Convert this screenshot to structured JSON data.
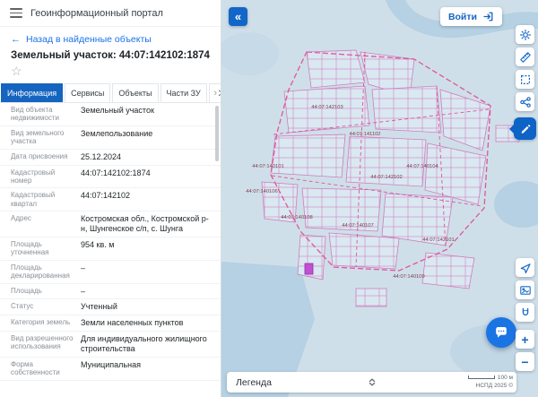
{
  "app": {
    "title": "Геоинформационный портал"
  },
  "icons": {
    "star": "☆",
    "back_arrow": "←",
    "tabs_more": "›"
  },
  "panel": {
    "back_link": "Назад в найденные объекты",
    "title": "Земельный участок: 44:07:142102:1874",
    "tabs": [
      {
        "label": "Информация"
      },
      {
        "label": "Сервисы"
      },
      {
        "label": "Объекты"
      },
      {
        "label": "Части ЗУ"
      },
      {
        "label": "Сост"
      }
    ],
    "rows": [
      {
        "label": "Вид объекта недвижимости",
        "value": "Земельный участок"
      },
      {
        "label": "Вид земельного участка",
        "value": "Землепользование"
      },
      {
        "label": "Дата присвоения",
        "value": "25.12.2024"
      },
      {
        "label": "Кадастровый номер",
        "value": "44:07:142102:1874"
      },
      {
        "label": "Кадастровый квартал",
        "value": "44:07:142102"
      },
      {
        "label": "Адрес",
        "value": "Костромская обл., Костромской р-н, Шунгенское с/п, с. Шунга"
      },
      {
        "label": "Площадь уточненная",
        "value": "954 кв. м"
      },
      {
        "label": "Площадь декларированная",
        "value": "–"
      },
      {
        "label": "Площадь",
        "value": "–"
      },
      {
        "label": "Статус",
        "value": "Учтенный"
      },
      {
        "label": "Категория земель",
        "value": "Земли населенных пунктов"
      },
      {
        "label": "Вид разрешенного использования",
        "value": "Для индивидуального жилищного строительства"
      },
      {
        "label": "Форма собственности",
        "value": "Муниципальная"
      }
    ]
  },
  "map": {
    "collapse_glyph": "«",
    "login_label": "Войти",
    "legend_label": "Легенда",
    "scale_label": "100 м",
    "attribution": "НСПД 2025 ©",
    "zoom_in": "+",
    "zoom_out": "−",
    "quarters": [
      {
        "text": "44:07:142103"
      },
      {
        "text": "44:07:141102"
      },
      {
        "text": "44:07:140101"
      },
      {
        "text": "44:07:140104"
      },
      {
        "text": "44:07:142102"
      },
      {
        "text": "44:07:140106"
      },
      {
        "text": "44:07:140108"
      },
      {
        "text": "44:07:140107"
      },
      {
        "text": "44:07:142101"
      },
      {
        "text": "44:07:140109"
      }
    ],
    "toolbar": [
      {
        "icon": "gear-icon"
      },
      {
        "icon": "ruler-icon"
      },
      {
        "icon": "select-region-icon"
      },
      {
        "icon": "share-icon"
      },
      {
        "icon": "draw-icon",
        "active": true
      },
      {
        "icon": "location-arrow-icon"
      },
      {
        "icon": "image-icon"
      },
      {
        "icon": "magnet-icon"
      },
      {
        "icon": "chat-icon"
      }
    ]
  },
  "colors": {
    "accent": "#1565c0",
    "parcel_line": "#d183c3",
    "quarter_line": "#e0559a",
    "selected_fill": "#c44fd0",
    "water": "#b5d1e3",
    "map_bg": "#cfdfe9"
  }
}
